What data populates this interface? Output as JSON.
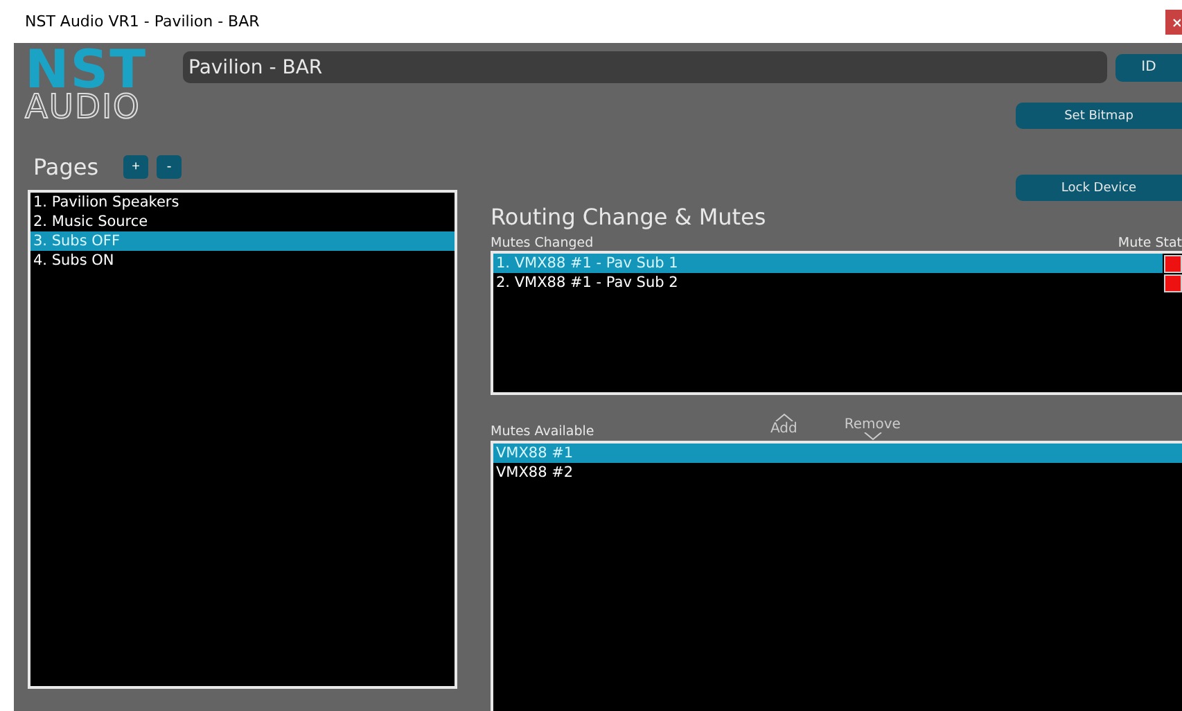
{
  "window": {
    "title": "NST Audio VR1 - Pavilion - BAR"
  },
  "logo": {
    "top": "NST",
    "bottom": "AUDIO"
  },
  "device_name": {
    "value": "Pavilion - BAR"
  },
  "buttons": {
    "id": "ID",
    "set_bitmap": "Set Bitmap",
    "lock_device": "Lock Device",
    "add_page": "+",
    "remove_page": "-"
  },
  "pages": {
    "label": "Pages",
    "items": [
      {
        "label": "1. Pavilion Speakers",
        "selected": false
      },
      {
        "label": "2. Music Source",
        "selected": false
      },
      {
        "label": "3. Subs OFF",
        "selected": true
      },
      {
        "label": "4. Subs ON",
        "selected": false
      }
    ]
  },
  "routing": {
    "title": "Routing Change & Mutes",
    "changed_label": "Mutes Changed",
    "state_label": "Mute Stat",
    "changed": [
      {
        "label": "1. VMX88 #1 - Pav Sub 1",
        "selected": true,
        "muted": true
      },
      {
        "label": "2. VMX88 #1 - Pav Sub 2",
        "selected": false,
        "muted": true
      }
    ],
    "add": "Add",
    "remove": "Remove",
    "available_label": "Mutes Available",
    "available": [
      {
        "label": "VMX88 #1",
        "selected": true
      },
      {
        "label": "VMX88 #2",
        "selected": false
      }
    ]
  }
}
